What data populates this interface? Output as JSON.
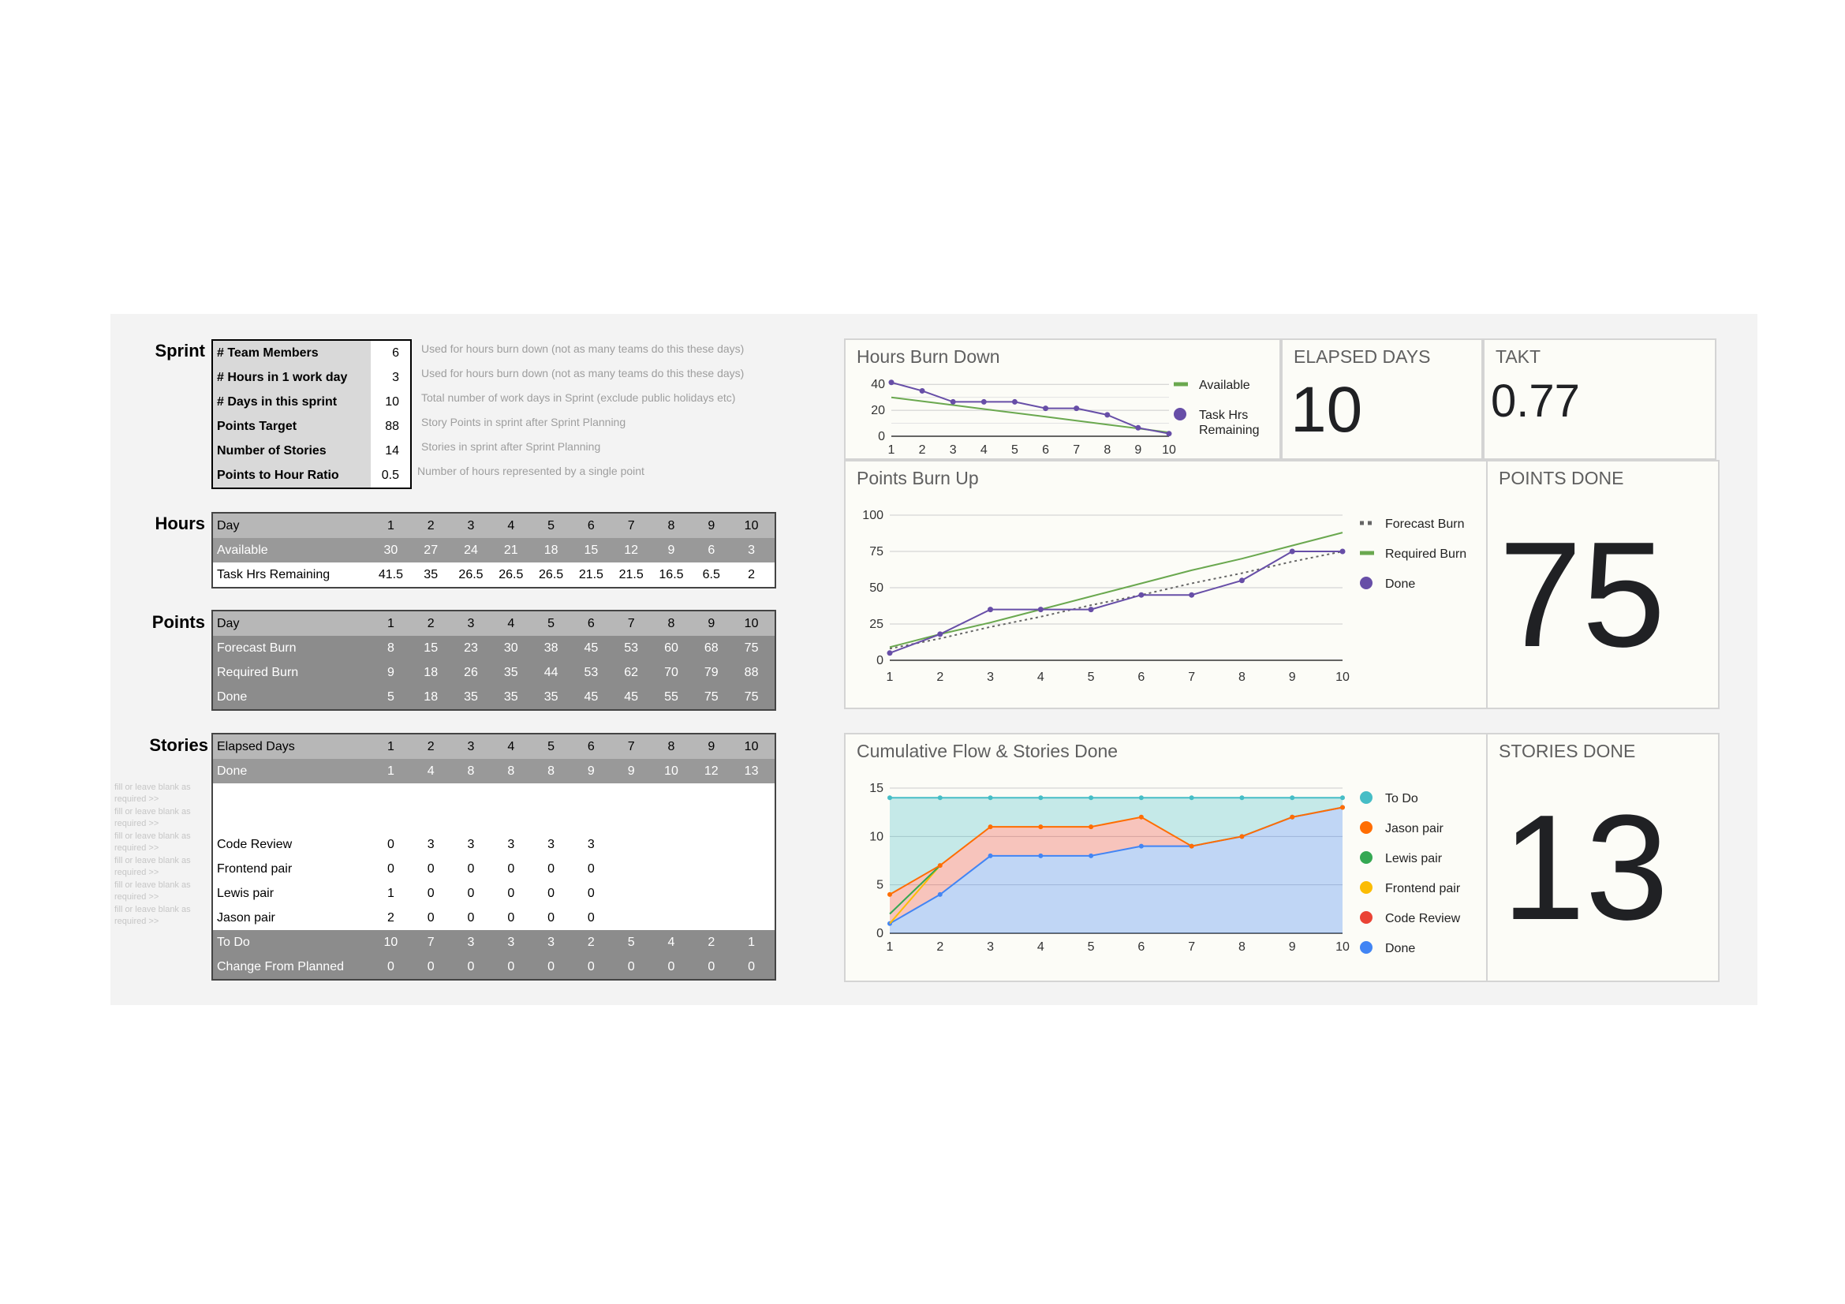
{
  "sections": {
    "sprint": "Sprint",
    "hours": "Hours",
    "points": "Points",
    "stories": "Stories"
  },
  "sprint": {
    "rows": [
      {
        "label": "# Team Members",
        "value": "6",
        "note": "Used for hours burn down (not as many teams do this these days)"
      },
      {
        "label": "# Hours in 1 work day",
        "value": "3",
        "note": "Used for hours burn down (not as many teams do this these days)"
      },
      {
        "label": "# Days in this sprint",
        "value": "10",
        "note": "Total number of work days in Sprint (exclude public holidays etc)"
      },
      {
        "label": "Points Target",
        "value": "88",
        "note": "Story Points in sprint after Sprint Planning"
      },
      {
        "label": "Number of Stories",
        "value": "14",
        "note": "Stories in sprint after Sprint Planning"
      },
      {
        "label": "Points to Hour Ratio",
        "value": "0.5",
        "note": "Number of hours represented by a single point"
      }
    ]
  },
  "hours_table": [
    {
      "label": "Day",
      "cells": [
        "1",
        "2",
        "3",
        "4",
        "5",
        "6",
        "7",
        "8",
        "9",
        "10"
      ]
    },
    {
      "label": "Available",
      "cells": [
        "30",
        "27",
        "24",
        "21",
        "18",
        "15",
        "12",
        "9",
        "6",
        "3"
      ]
    },
    {
      "label": "Task Hrs Remaining",
      "cells": [
        "41.5",
        "35",
        "26.5",
        "26.5",
        "26.5",
        "21.5",
        "21.5",
        "16.5",
        "6.5",
        "2"
      ]
    }
  ],
  "points_table": [
    {
      "label": "Day",
      "cells": [
        "1",
        "2",
        "3",
        "4",
        "5",
        "6",
        "7",
        "8",
        "9",
        "10"
      ]
    },
    {
      "label": "Forecast Burn",
      "cells": [
        "8",
        "15",
        "23",
        "30",
        "38",
        "45",
        "53",
        "60",
        "68",
        "75"
      ]
    },
    {
      "label": "Required Burn",
      "cells": [
        "9",
        "18",
        "26",
        "35",
        "44",
        "53",
        "62",
        "70",
        "79",
        "88"
      ]
    },
    {
      "label": "Done",
      "cells": [
        "5",
        "18",
        "35",
        "35",
        "35",
        "45",
        "45",
        "55",
        "75",
        "75"
      ]
    }
  ],
  "stories_table": [
    {
      "label": "Elapsed Days",
      "cells": [
        "1",
        "2",
        "3",
        "4",
        "5",
        "6",
        "7",
        "8",
        "9",
        "10"
      ]
    },
    {
      "label": "Done",
      "cells": [
        "1",
        "4",
        "8",
        "8",
        "8",
        "9",
        "9",
        "10",
        "12",
        "13"
      ]
    },
    {
      "label": "",
      "cells": [
        "",
        "",
        "",
        "",
        "",
        "",
        "",
        "",
        "",
        ""
      ]
    },
    {
      "label": "",
      "cells": [
        "",
        "",
        "",
        "",
        "",
        "",
        "",
        "",
        "",
        ""
      ]
    },
    {
      "label": "Code Review",
      "cells": [
        "0",
        "3",
        "3",
        "3",
        "3",
        "3",
        "",
        "",
        "",
        ""
      ]
    },
    {
      "label": "Frontend pair",
      "cells": [
        "0",
        "0",
        "0",
        "0",
        "0",
        "0",
        "",
        "",
        "",
        ""
      ]
    },
    {
      "label": "Lewis pair",
      "cells": [
        "1",
        "0",
        "0",
        "0",
        "0",
        "0",
        "",
        "",
        "",
        ""
      ]
    },
    {
      "label": "Jason pair",
      "cells": [
        "2",
        "0",
        "0",
        "0",
        "0",
        "0",
        "",
        "",
        "",
        ""
      ]
    },
    {
      "label": "To Do",
      "cells": [
        "10",
        "7",
        "3",
        "3",
        "3",
        "2",
        "5",
        "4",
        "2",
        "1"
      ]
    },
    {
      "label": "Change From Planned",
      "cells": [
        "0",
        "0",
        "0",
        "0",
        "0",
        "0",
        "0",
        "0",
        "0",
        "0"
      ]
    }
  ],
  "fill_note": "fill or leave blank as required >>",
  "cards": {
    "elapsed": {
      "title": "ELAPSED DAYS",
      "value": "10"
    },
    "takt": {
      "title": "TAKT",
      "value": "0.77"
    },
    "points_done": {
      "title": "POINTS DONE",
      "value": "75"
    },
    "stories_done": {
      "title": "STORIES DONE",
      "value": "13"
    }
  },
  "chart_data": [
    {
      "type": "line",
      "title": "Hours Burn Down",
      "x": [
        1,
        2,
        3,
        4,
        5,
        6,
        7,
        8,
        9,
        10
      ],
      "ylim": [
        0,
        45
      ],
      "yticks": [
        "0",
        "20",
        "40"
      ],
      "series": [
        {
          "name": "Available",
          "values": [
            30,
            27,
            24,
            21,
            18,
            15,
            12,
            9,
            6,
            3
          ],
          "color": "#6aa84f"
        },
        {
          "name": "Task Hrs Remaining",
          "values": [
            41.5,
            35,
            26.5,
            26.5,
            26.5,
            21.5,
            21.5,
            16.5,
            6.5,
            2
          ],
          "color": "#674ea7"
        }
      ],
      "legend": "right"
    },
    {
      "type": "line",
      "title": "Points Burn Up",
      "x": [
        1,
        2,
        3,
        4,
        5,
        6,
        7,
        8,
        9,
        10
      ],
      "ylim": [
        0,
        100
      ],
      "yticks": [
        "0",
        "25",
        "50",
        "75",
        "100"
      ],
      "series": [
        {
          "name": "Forecast Burn",
          "values": [
            8,
            15,
            23,
            30,
            38,
            45,
            53,
            60,
            68,
            75
          ],
          "color": "#666666"
        },
        {
          "name": "Required Burn",
          "values": [
            9,
            18,
            26,
            35,
            44,
            53,
            62,
            70,
            79,
            88
          ],
          "color": "#6aa84f"
        },
        {
          "name": "Done",
          "values": [
            5,
            18,
            35,
            35,
            35,
            45,
            45,
            55,
            75,
            75
          ],
          "color": "#674ea7"
        }
      ],
      "legend": "right"
    },
    {
      "type": "area",
      "title": "Cumulative Flow & Stories Done",
      "x": [
        1,
        2,
        3,
        4,
        5,
        6,
        7,
        8,
        9,
        10
      ],
      "ylim": [
        0,
        15
      ],
      "yticks": [
        "0",
        "5",
        "10",
        "15"
      ],
      "series": [
        {
          "name": "To Do",
          "values": [
            14,
            14,
            14,
            14,
            14,
            14,
            14,
            14,
            14,
            14
          ],
          "color": "#46bdc6"
        },
        {
          "name": "Jason pair",
          "values": [
            4,
            7,
            11,
            11,
            11,
            12,
            9,
            10,
            12,
            13
          ],
          "color": "#ff6d01"
        },
        {
          "name": "Lewis pair",
          "values": [
            2,
            7,
            null,
            null,
            null,
            null,
            null,
            null,
            null,
            null
          ],
          "color": "#34a853"
        },
        {
          "name": "Frontend pair",
          "values": [
            1,
            7,
            null,
            null,
            null,
            null,
            null,
            null,
            null,
            null
          ],
          "color": "#fbbc04"
        },
        {
          "name": "Code Review",
          "values": [
            1,
            7,
            11,
            11,
            11,
            12,
            null,
            null,
            null,
            null
          ],
          "color": "#ea4335"
        },
        {
          "name": "Done",
          "values": [
            1,
            4,
            8,
            8,
            8,
            9,
            9,
            10,
            12,
            13
          ],
          "color": "#4285f4"
        }
      ],
      "legend": "right"
    }
  ]
}
